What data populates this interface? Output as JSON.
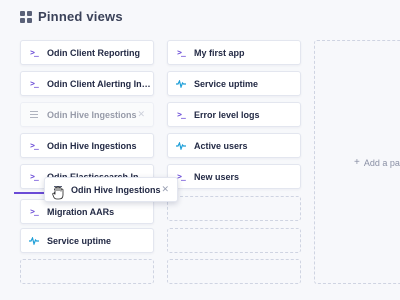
{
  "header": {
    "title": "Pinned views",
    "icon": "grid-icon"
  },
  "accent": "#6a4bd6",
  "column1": [
    {
      "label": "Odin Client Reporting",
      "icon": "terminal-icon"
    },
    {
      "label": "Odin Client Alerting Ingestions",
      "icon": "terminal-icon"
    },
    {
      "label": "Odin Hive Ingestions",
      "icon": "list-icon",
      "ghost": true
    },
    {
      "label": "Odin Hive Ingestions",
      "icon": "terminal-icon"
    },
    {
      "label": "Odin Elasticsearch Ingestions",
      "icon": "terminal-icon"
    },
    {
      "label": "Migration AARs",
      "icon": "terminal-icon"
    },
    {
      "label": "Service uptime",
      "icon": "pulse-icon"
    }
  ],
  "column2": [
    {
      "label": "My first app",
      "icon": "terminal-icon"
    },
    {
      "label": "Service uptime",
      "icon": "pulse-icon"
    },
    {
      "label": "Error level logs",
      "icon": "terminal-icon"
    },
    {
      "label": "Active users",
      "icon": "pulse-icon"
    },
    {
      "label": "New users",
      "icon": "terminal-icon"
    }
  ],
  "dragging": {
    "label": "Odin Hive Ingestions",
    "icon": "list-icon"
  },
  "add_page": {
    "label": "Add a page"
  }
}
